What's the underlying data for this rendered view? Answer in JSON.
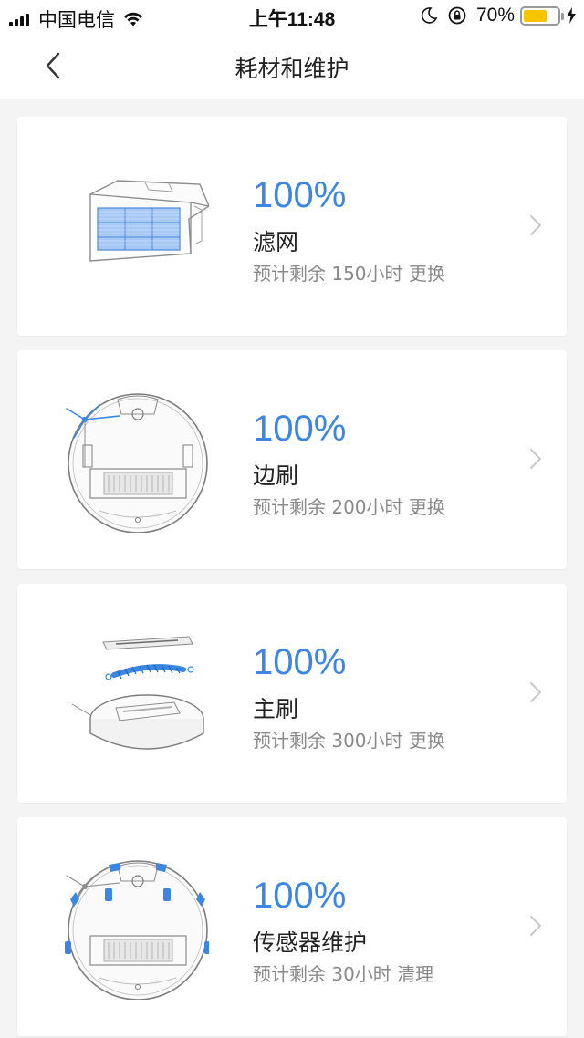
{
  "status_bar": {
    "carrier": "中国电信",
    "time": "上午11:48",
    "battery_percent": "70%",
    "battery_level": 0.7,
    "icons": [
      "signal-icon",
      "wifi-icon",
      "moon-icon",
      "orientation-lock-icon",
      "battery-icon",
      "charging-icon"
    ]
  },
  "nav": {
    "title": "耗材和维护",
    "back_icon": "chevron-left-icon"
  },
  "colors": {
    "accent": "#3a86e0",
    "background": "#f4f4f4",
    "card": "#ffffff",
    "subtext": "#8a8a8a"
  },
  "items": [
    {
      "percent": "100%",
      "name": "滤网",
      "remaining": "预计剩余 150小时 更换",
      "icon": "filter-illustration"
    },
    {
      "percent": "100%",
      "name": "边刷",
      "remaining": "预计剩余 200小时 更换",
      "icon": "side-brush-illustration"
    },
    {
      "percent": "100%",
      "name": "主刷",
      "remaining": "预计剩余 300小时 更换",
      "icon": "main-brush-illustration"
    },
    {
      "percent": "100%",
      "name": "传感器维护",
      "remaining": "预计剩余 30小时 清理",
      "icon": "sensor-illustration"
    }
  ]
}
